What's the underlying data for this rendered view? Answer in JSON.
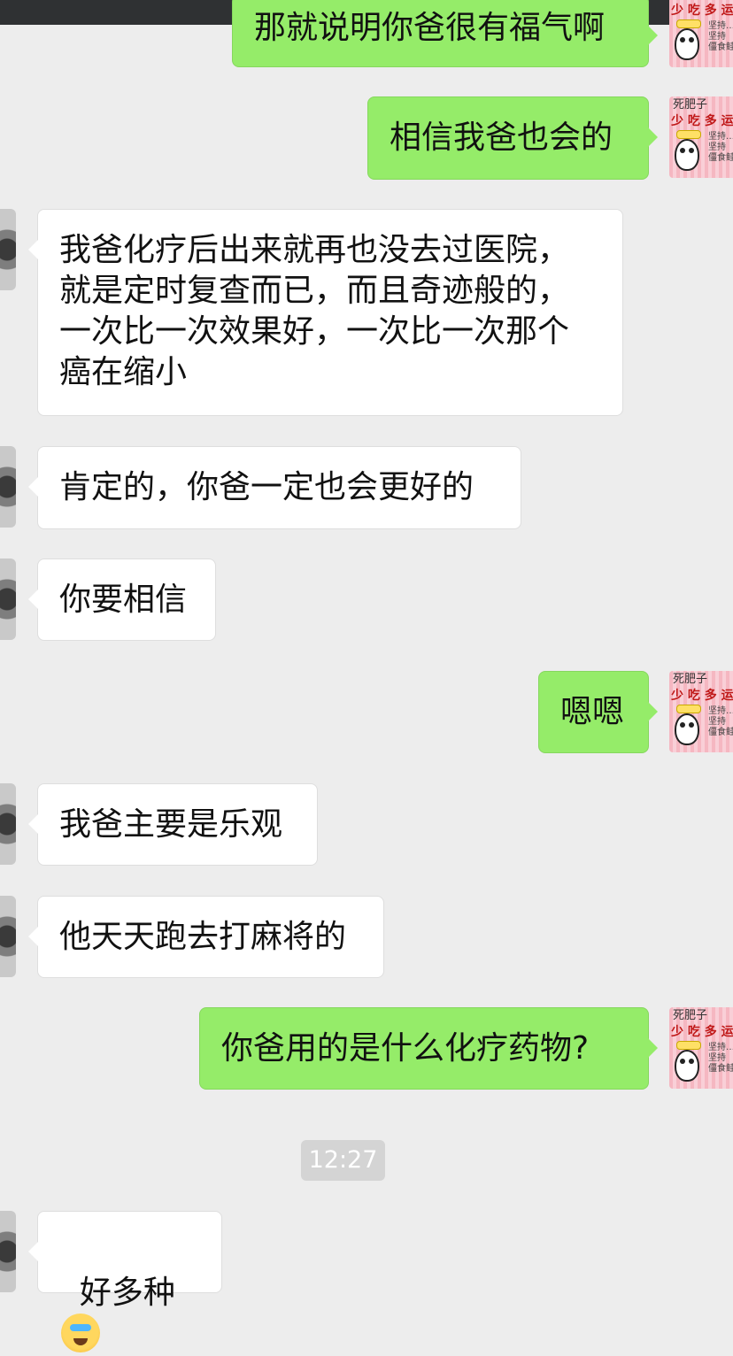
{
  "chat": {
    "messages": [
      {
        "side": "out",
        "text": "那就说明你爸很有福气啊"
      },
      {
        "side": "out",
        "text": "相信我爸也会的"
      },
      {
        "side": "in",
        "text": "我爸化疗后出来就再也没去过医院，\n就是定时复查而已，而且奇迹般的，\n一次比一次效果好，一次比一次那个\n癌在缩小"
      },
      {
        "side": "in",
        "text": "肯定的，你爸一定也会更好的"
      },
      {
        "side": "in",
        "text": "你要相信"
      },
      {
        "side": "out",
        "text": "嗯嗯"
      },
      {
        "side": "in",
        "text": "我爸主要是乐观"
      },
      {
        "side": "in",
        "text": "他天天跑去打麻将的"
      },
      {
        "side": "out",
        "text": "你爸用的是什么化疗药物?"
      },
      {
        "side": "in",
        "text": "好多种",
        "emoji": "crying-face-emoji"
      }
    ],
    "timestamp": "12:27"
  },
  "avatar_self": {
    "caption_top": "死肥子",
    "caption_main": "少 吃 多 运",
    "caption_side": "坚持…\n坚持\n僵食鲑…"
  },
  "colors": {
    "background": "#ededed",
    "bubble_out": "#95ec69",
    "bubble_in": "#ffffff",
    "status_bar": "#2f3133"
  }
}
